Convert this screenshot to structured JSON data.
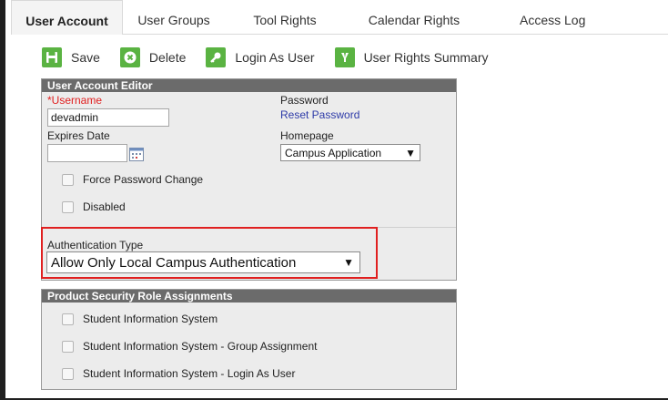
{
  "tabs": [
    {
      "label": "User Account"
    },
    {
      "label": "User Groups"
    },
    {
      "label": "Tool Rights"
    },
    {
      "label": "Calendar Rights"
    },
    {
      "label": "Access Log"
    }
  ],
  "toolbar": {
    "save_label": "Save",
    "delete_label": "Delete",
    "login_as_user_label": "Login As User",
    "user_rights_summary_label": "User Rights Summary"
  },
  "editor": {
    "title": "User Account Editor",
    "username_required_mark": "*",
    "username_label": "Username",
    "username_value": "devadmin",
    "password_label": "Password",
    "reset_password_link": "Reset Password",
    "expires_date_label": "Expires Date",
    "expires_date_value": "",
    "homepage_label": "Homepage",
    "homepage_value": "Campus Application",
    "force_password_change_label": "Force Password Change",
    "disabled_label": "Disabled",
    "authentication_type_label": "Authentication Type",
    "authentication_type_value": "Allow Only Local Campus Authentication"
  },
  "roles": {
    "title": "Product Security Role Assignments",
    "items": [
      {
        "label": "Student Information System"
      },
      {
        "label": "Student Information System - Group Assignment"
      },
      {
        "label": "Student Information System - Login As User"
      }
    ]
  },
  "colors": {
    "accent_green": "#5ab342",
    "panel_header": "#6b6b6b",
    "highlight_red": "#e02020",
    "link_blue": "#2d3aa8"
  }
}
